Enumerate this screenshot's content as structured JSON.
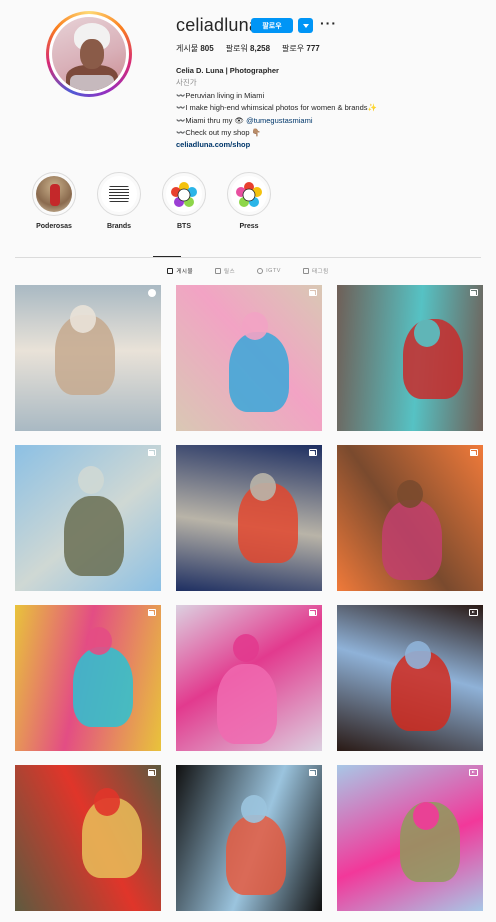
{
  "profile": {
    "username": "celiadluna",
    "follow_label": "팔로우",
    "stats": {
      "posts_label": "게시물",
      "posts_count": "805",
      "followers_label": "팔로워",
      "followers_count": "8,258",
      "following_label": "팔로우",
      "following_count": "777"
    },
    "bio": {
      "name": "Celia D. Luna | Photographer",
      "category": "사진가",
      "line1": "〰️Peruvian living in Miami",
      "line2": "〰️I make high-end whimsical photos for women & brands✨",
      "line3_prefix": "〰️Miami thru my 👁",
      "line3_mention": "@tumegustasmiami",
      "line4": "〰️Check out my shop 👇🏽",
      "link": "celiadluna.com/shop"
    }
  },
  "highlights": [
    {
      "label": "Poderosas"
    },
    {
      "label": "Brands"
    },
    {
      "label": "BTS"
    },
    {
      "label": "Press"
    }
  ],
  "tabs": [
    {
      "label": "게시물",
      "icon": "grid-icon"
    },
    {
      "label": "릴스",
      "icon": "reels-icon"
    },
    {
      "label": "IGTV",
      "icon": "igtv-icon"
    },
    {
      "label": "태그됨",
      "icon": "tagged-icon"
    }
  ],
  "posts": [
    {
      "type": "reel",
      "colors": [
        "#a9b9c3",
        "#e9e2d8",
        "#c5a98e"
      ]
    },
    {
      "type": "multi",
      "colors": [
        "#d9c8b4",
        "#f2a3c4",
        "#3aa7d9"
      ]
    },
    {
      "type": "multi",
      "colors": [
        "#6f5f57",
        "#56c2c4",
        "#c92a2a"
      ]
    },
    {
      "type": "multi",
      "colors": [
        "#8cc0e4",
        "#cfd8d4",
        "#6a6f52"
      ]
    },
    {
      "type": "multi",
      "colors": [
        "#1e2f62",
        "#b9b4a8",
        "#e2472e"
      ]
    },
    {
      "type": "multi",
      "colors": [
        "#f07a3a",
        "#7a4a2e",
        "#c23f6d"
      ]
    },
    {
      "type": "multi",
      "colors": [
        "#e8c33b",
        "#e34d84",
        "#2bc2d2"
      ]
    },
    {
      "type": "multi",
      "colors": [
        "#dcd0e0",
        "#e23a8e",
        "#f06ab0"
      ]
    },
    {
      "type": "video",
      "colors": [
        "#2a1a15",
        "#8fb2d8",
        "#d12a1f"
      ]
    },
    {
      "type": "multi",
      "colors": [
        "#5e5a3f",
        "#e0352a",
        "#e8c05a"
      ]
    },
    {
      "type": "multi",
      "colors": [
        "#111111",
        "#9bc4de",
        "#e55a3f"
      ]
    },
    {
      "type": "video",
      "colors": [
        "#a8c7e6",
        "#f2389a",
        "#8f9a5a"
      ]
    }
  ]
}
